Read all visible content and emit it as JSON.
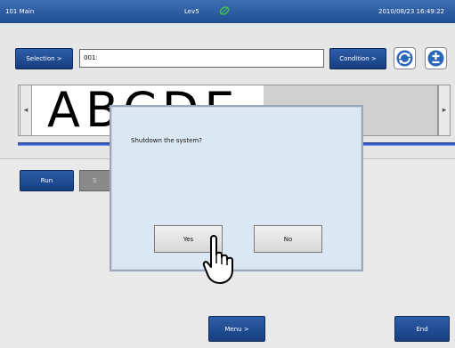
{
  "status_bar": {
    "screen_id": "101 Main",
    "level": "Lev5",
    "datetime": "2010/08/23 16:49:22",
    "leaf_icon": "leaf-icon"
  },
  "selection_row": {
    "selection_label": "Selection >",
    "selection_value": "001:",
    "condition_label": "Condition >",
    "refresh_icon": "refresh-icon",
    "plusminus_icon": "plus-minus-icon"
  },
  "preview": {
    "text": "ABCDE",
    "left_arrow": "◂",
    "right_arrow": "▸"
  },
  "panel": {
    "run_label": "Run",
    "second_partial": "S"
  },
  "footer": {
    "menu_label": "Menu >",
    "end_label": "End"
  },
  "dialog": {
    "message": "Shutdown the system?",
    "yes_label": "Yes",
    "no_label": "No"
  },
  "colors": {
    "accent_blue": "#1f4d93",
    "dialog_bg": "#dbe7f3"
  }
}
